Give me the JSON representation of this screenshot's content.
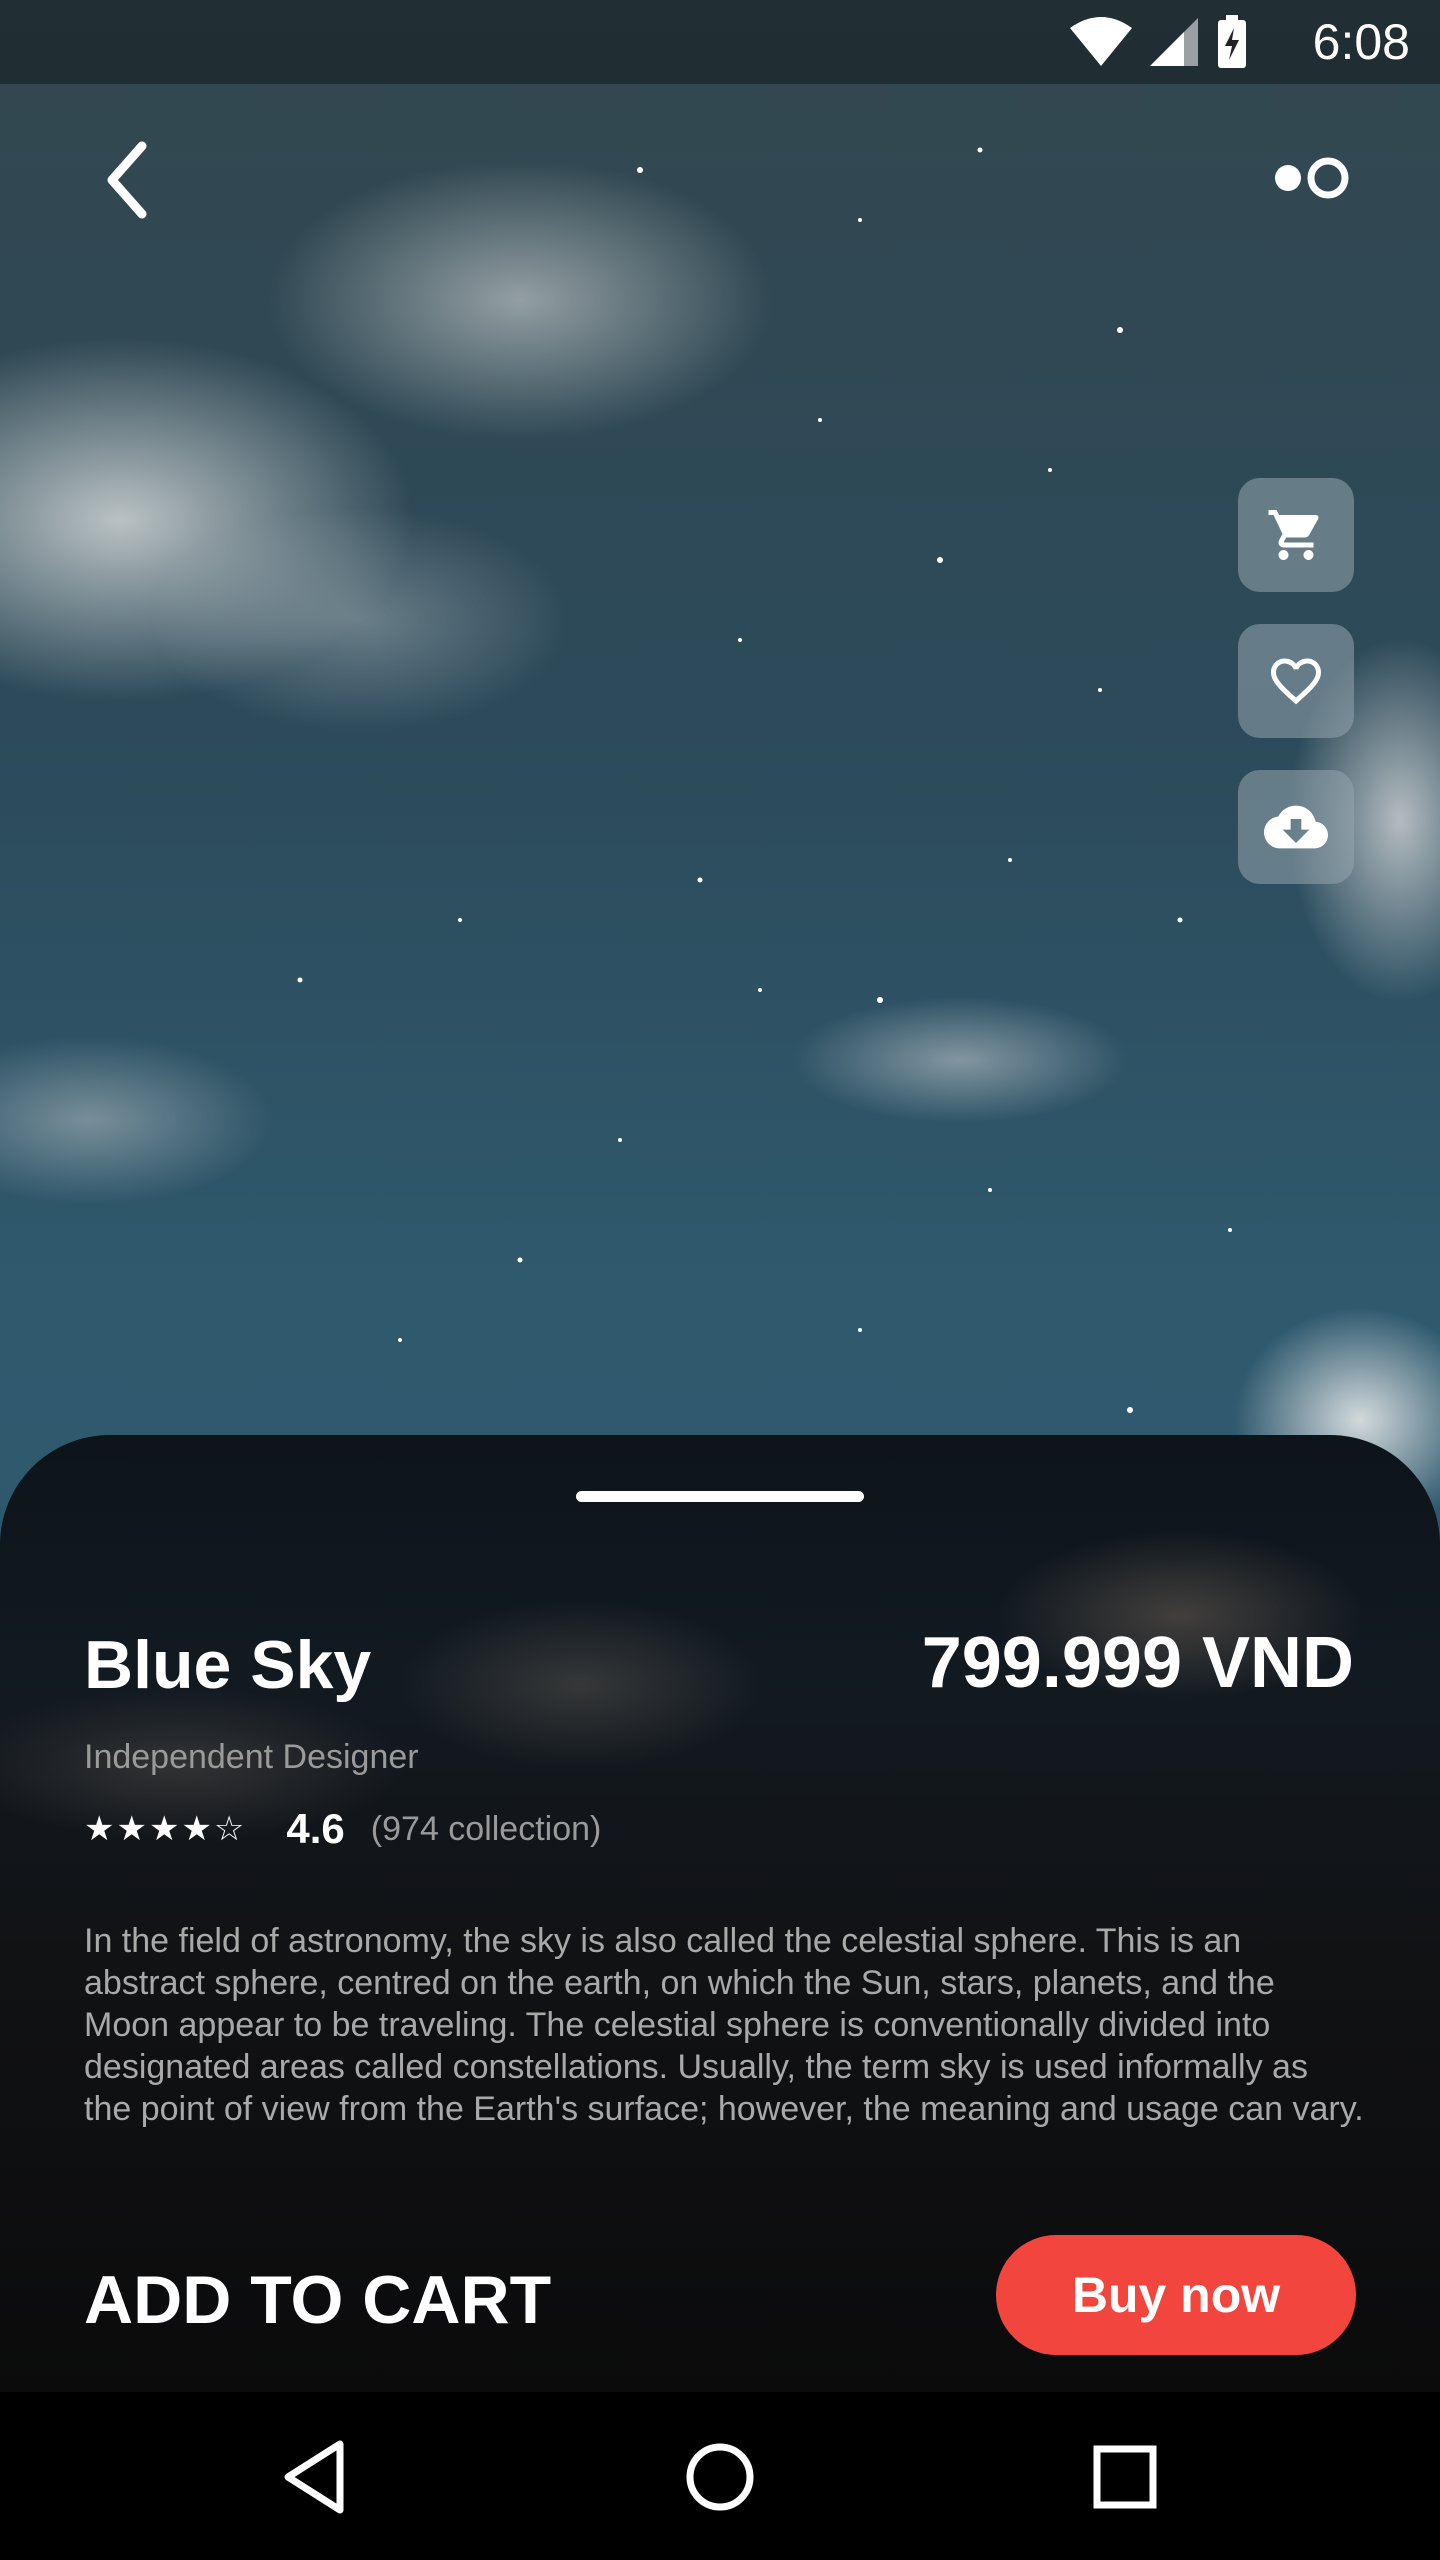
{
  "status_bar": {
    "time": "6:08"
  },
  "product": {
    "title": "Blue Sky",
    "price": "799.999 VND",
    "designer": "Independent Designer",
    "rating_stars": "★★★★☆",
    "rating_value": "4.6",
    "rating_count": "(974 collection)",
    "description": "In the field of astronomy, the sky is also called the celestial sphere. This is an abstract sphere, centred on the earth, on which the Sun, stars, planets, and the Moon appear to be traveling. The celestial sphere is conventionally divided into designated areas called constellations. Usually, the term sky is used informally as the point of view from the Earth's surface; however, the meaning and usage can vary."
  },
  "actions": {
    "add_to_cart": "ADD TO CART",
    "buy_now": "Buy now"
  },
  "colors": {
    "accent": "#f2453d",
    "sheet_bg": "#111214",
    "muted_text": "#9a9a9a"
  },
  "icons": {
    "back": "chevron-left-icon",
    "more": "dots-toggle-icon",
    "cart": "cart-icon",
    "favorite": "heart-icon",
    "download": "cloud-download-icon",
    "nav_back": "triangle-back-icon",
    "nav_home": "circle-home-icon",
    "nav_recents": "square-recents-icon"
  }
}
